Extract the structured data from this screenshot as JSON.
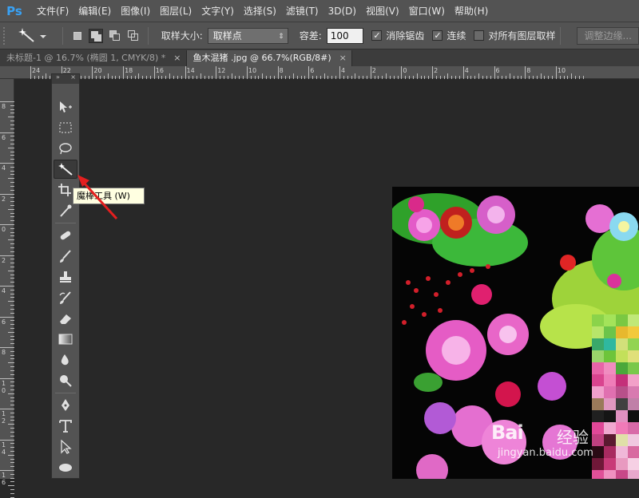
{
  "app": {
    "logo": "Ps"
  },
  "menu": [
    "文件(F)",
    "编辑(E)",
    "图像(I)",
    "图层(L)",
    "文字(Y)",
    "选择(S)",
    "滤镜(T)",
    "3D(D)",
    "视图(V)",
    "窗口(W)",
    "帮助(H)"
  ],
  "options": {
    "sample_size_label": "取样大小:",
    "sample_size_value": "取样点",
    "tolerance_label": "容差:",
    "tolerance_value": "100",
    "antialias_label": "消除锯齿",
    "antialias_checked": true,
    "contiguous_label": "连续",
    "contiguous_checked": true,
    "sample_all_label": "对所有图层取样",
    "sample_all_checked": false,
    "refine_edge_label": "调整边缘..."
  },
  "tabs": [
    {
      "label": "未标题-1 @ 16.7% (椭圆 1, CMYK/8) *",
      "close": "×",
      "active": false
    },
    {
      "label": "鱼木混猪 .jpg @ 66.7%(RGB/8#)",
      "close": "×",
      "active": true
    }
  ],
  "ruler": {
    "top_labels": [
      "24",
      "22",
      "20",
      "18",
      "16",
      "14",
      "12",
      "10",
      "8",
      "6",
      "4",
      "2",
      "0",
      "2",
      "4",
      "6",
      "8",
      "10"
    ],
    "left_labels": [
      "8",
      "6",
      "4",
      "2",
      "0",
      "2",
      "4",
      "6",
      "8",
      "1 0",
      "1 2",
      "1 4",
      "1 6"
    ]
  },
  "toolbox": {
    "header_left": "»",
    "header_right": "×",
    "tools": [
      "move-tool",
      "marquee-tool",
      "lasso-tool",
      "magic-wand-tool",
      "crop-tool",
      "eyedropper-tool",
      "healing-brush-tool",
      "brush-tool",
      "clone-stamp-tool",
      "history-brush-tool",
      "eraser-tool",
      "gradient-tool",
      "blur-tool",
      "dodge-tool",
      "pen-tool",
      "type-tool",
      "path-selection-tool",
      "ellipse-tool"
    ],
    "active_tool": "magic-wand-tool"
  },
  "tooltip": "魔棒工具 (W)",
  "watermark": {
    "brand": "Bai",
    "cn": "经验",
    "url": "jingyan.baidu.com"
  },
  "colors": {
    "ps_blue": "#39a2f5",
    "arrow_red": "#e41f1f",
    "tooltip_bg": "#ffffe1"
  }
}
